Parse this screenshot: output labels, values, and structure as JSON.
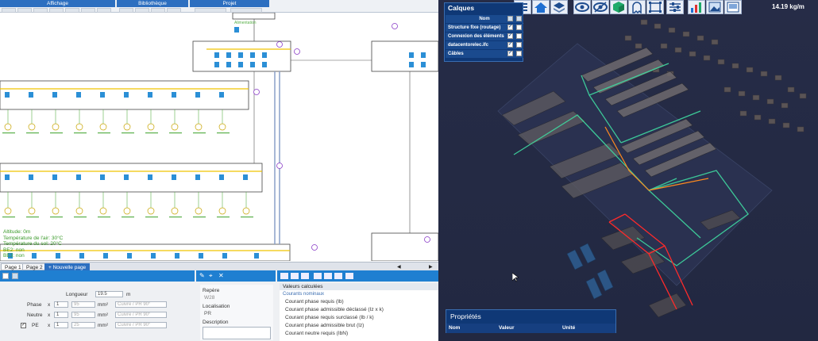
{
  "ribbon": {
    "tabs": [
      "Affichage",
      "Bibliothèque",
      "Projet"
    ]
  },
  "schematic": {
    "feeder_label": "Alimentation",
    "notes": [
      "Altitude: 0m",
      "Température de l'air: 30°C",
      "Température du sol: 20°C",
      "BE2: non",
      "BE3: non"
    ]
  },
  "pagebar": {
    "tabs": [
      "Page 1",
      "Page 2"
    ],
    "new_page": "Nouvelle page"
  },
  "cable_form": {
    "longueur_label": "Longueur",
    "longueur_value": "19.5",
    "longueur_unit": "m",
    "rows": [
      {
        "label": "Phase",
        "mult": "x",
        "count": "1",
        "section": "95",
        "unit": "mm²",
        "material": "Cuivre / PR 90°",
        "checkbox": false
      },
      {
        "label": "Neutre",
        "mult": "x",
        "count": "1",
        "section": "95",
        "unit": "mm²",
        "material": "Cuivre / PR 90°",
        "checkbox": false
      },
      {
        "label": "PE",
        "mult": "x",
        "count": "1",
        "section": "25",
        "unit": "mm²",
        "material": "Cuivre / PR 90°",
        "checkbox": true
      }
    ]
  },
  "repere": {
    "label": "Repère",
    "value": "W28",
    "localisation_label": "Localisation",
    "localisation_value": "PR",
    "description_label": "Description"
  },
  "calc": {
    "title": "Valeurs calculées",
    "section": "Courants nominaux",
    "items": [
      "Courant phase requis (Ib)",
      "Courant phase admissible déclassé (Iz x k)",
      "Courant phase requis surclassé (Ib / k)",
      "Courant phase admissible brut (Iz)",
      "Courant neutre requis (IbN)"
    ]
  },
  "viewer": {
    "weight": "14.19 kg/m",
    "toolbar_icons": [
      "list-icon",
      "home-icon",
      "layers-icon",
      "eye-icon",
      "eye-off-icon",
      "cube-icon",
      "ghost-icon",
      "frame-icon",
      "sliders-icon",
      "bar-chart-icon",
      "image-icon",
      "screenshot-icon"
    ],
    "cable_color": "#3fd9a0",
    "accent_orange": "#ff8a1e",
    "accent_red": "#ff2a2a"
  },
  "calques": {
    "title": "Calques",
    "header": "Nom",
    "layers": [
      {
        "name": "Structure fixe (routage)",
        "visible": true
      },
      {
        "name": "Connexion des éléments",
        "visible": true
      },
      {
        "name": "datacentorelec.ifc",
        "visible": true
      },
      {
        "name": "Câbles",
        "visible": true
      }
    ]
  },
  "proprietes": {
    "title": "Propriétés",
    "columns": [
      "Nom",
      "Valeur",
      "Unité"
    ]
  }
}
